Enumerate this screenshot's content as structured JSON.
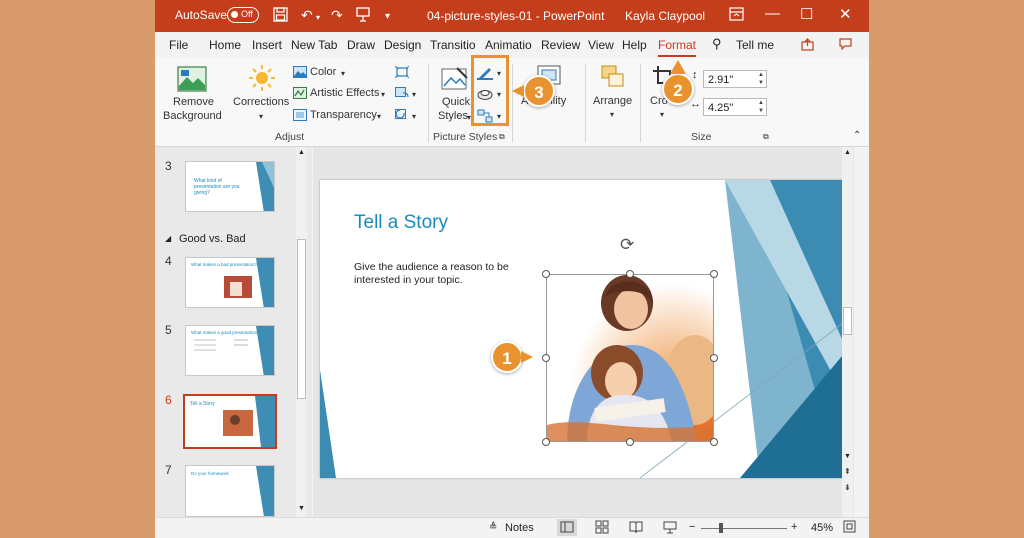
{
  "titlebar": {
    "autosave": "AutoSave",
    "toggle": "Off",
    "document": "04-picture-styles-01",
    "app": "PowerPoint",
    "title_sep": " - ",
    "user": "Kayla Claypool",
    "icons": [
      "save-icon",
      "undo-icon",
      "redo-icon",
      "present-icon",
      "customize-icon"
    ]
  },
  "tabs": [
    "File",
    "Home",
    "Insert",
    "New Tab",
    "Draw",
    "Design",
    "Transitio",
    "Animatio",
    "Review",
    "View",
    "Help",
    "Format",
    "Tell me"
  ],
  "active_tab": "Format",
  "ribbon": {
    "remove_bg": [
      "Remove",
      "Background"
    ],
    "corrections": "Corrections",
    "color": "Color",
    "artistic": "Artistic Effects",
    "transparency": "Transparency",
    "adjust_label": "Adjust",
    "quick_styles": [
      "Quick",
      "Styles"
    ],
    "picture_styles_label": "Picture Styles",
    "accessibility": "A  ssibility",
    "arrange": "Arrange",
    "crop": "Cro",
    "height": "2.91\"",
    "width": "4.25\"",
    "size_label": "Size"
  },
  "thumbnails": {
    "section": "Good vs. Bad",
    "items": [
      {
        "num": "3",
        "text": "What kind of presentation are you giving?"
      },
      {
        "num": "4",
        "text": "What makes a bad presentation?"
      },
      {
        "num": "5",
        "text": "What makes a good presentation?"
      },
      {
        "num": "6",
        "text": "Tell a Story"
      },
      {
        "num": "7",
        "text": "Do your homework"
      }
    ]
  },
  "slide": {
    "title": "Tell a Story",
    "body": "Give the audience a reason to be interested in your topic."
  },
  "status": {
    "notes": "Notes",
    "zoom": "45%"
  },
  "callouts": [
    "1",
    "2",
    "3"
  ],
  "colors": {
    "accent": "#c43e1c",
    "callout": "#e8932f",
    "slide_title": "#1b8bbf",
    "background": "#d99a6c"
  }
}
